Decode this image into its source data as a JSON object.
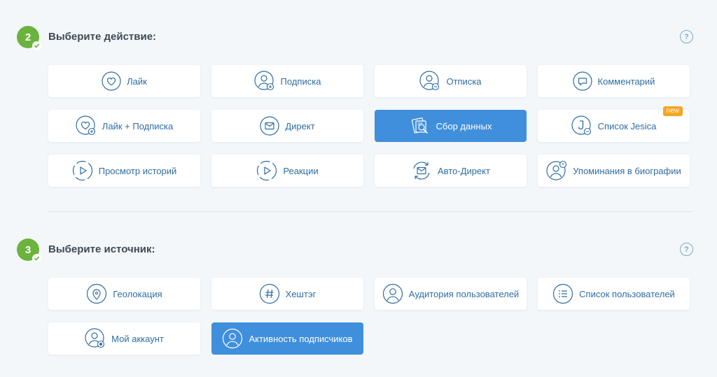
{
  "step2": {
    "number": "2",
    "title": "Выберите действие:",
    "help": "?",
    "actions": [
      {
        "label": "Лайк",
        "icon": "heart-icon"
      },
      {
        "label": "Подписка",
        "icon": "user-plus-icon"
      },
      {
        "label": "Отписка",
        "icon": "user-minus-icon"
      },
      {
        "label": "Комментарий",
        "icon": "comment-icon"
      },
      {
        "label": "Лайк + Подписка",
        "icon": "heart-plus-icon"
      },
      {
        "label": "Директ",
        "icon": "mail-icon"
      },
      {
        "label": "Сбор данных",
        "icon": "data-collection-icon",
        "active": true
      },
      {
        "label": "Список Jesica",
        "icon": "j-icon",
        "badge": "new"
      },
      {
        "label": "Просмотр историй",
        "icon": "story-play-icon"
      },
      {
        "label": "Реакции",
        "icon": "story-play-icon"
      },
      {
        "label": "Авто-Директ",
        "icon": "auto-mail-icon"
      },
      {
        "label": "Упоминания в биографии",
        "icon": "user-mention-icon"
      }
    ]
  },
  "step3": {
    "number": "3",
    "title": "Выберите источник:",
    "help": "?",
    "sources": [
      {
        "label": "Геолокация",
        "icon": "location-pin-icon"
      },
      {
        "label": "Хештэг",
        "icon": "hashtag-icon"
      },
      {
        "label": "Аудитория пользователей",
        "icon": "user-icon"
      },
      {
        "label": "Список пользователей",
        "icon": "list-icon"
      },
      {
        "label": "Мой аккаунт",
        "icon": "user-dot-icon"
      },
      {
        "label": "Активность подписчиков",
        "icon": "user-icon",
        "active": true
      }
    ]
  },
  "colors": {
    "accent": "#3f8fdc",
    "step_badge": "#6cb33e",
    "text": "#2e6da4",
    "new_badge": "#f5a623"
  }
}
